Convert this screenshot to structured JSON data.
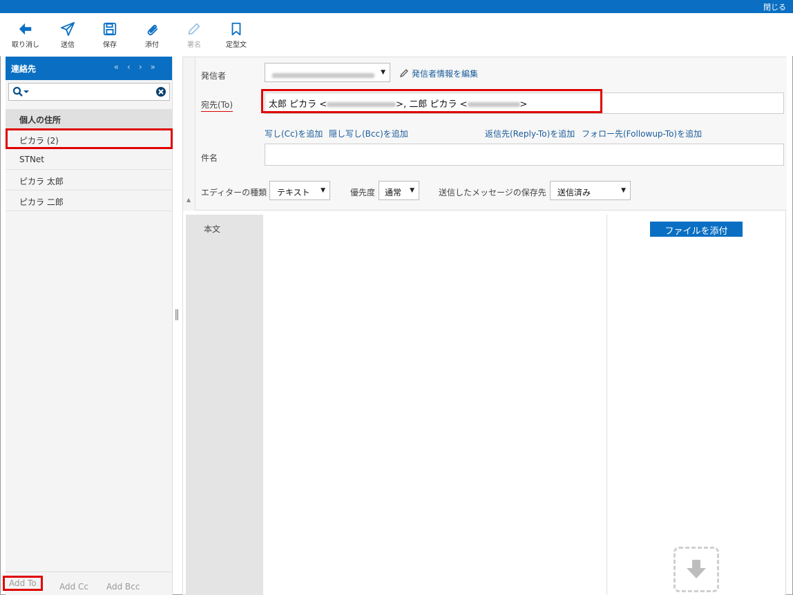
{
  "window": {
    "close_label": "閉じる"
  },
  "toolbar": {
    "undo": "取り消し",
    "send": "送信",
    "save": "保存",
    "attach": "添付",
    "signature": "署名",
    "template": "定型文"
  },
  "sidebar": {
    "title": "連絡先",
    "nav_first": "«",
    "nav_prev": "‹",
    "nav_next": "›",
    "nav_last": "»",
    "group": "個人の住所",
    "items": [
      {
        "label": "ピカラ (2)"
      },
      {
        "label": "STNet"
      },
      {
        "label": "ピカラ 太郎"
      },
      {
        "label": "ピカラ 二郎"
      }
    ],
    "add_to": "Add To",
    "add_cc": "Add Cc",
    "add_bcc": "Add Bcc"
  },
  "form": {
    "from_label": "発信者",
    "edit_sender": "発信者情報を編集",
    "to_label": "宛先(To)",
    "to_name1": "太郎 ピカラ <",
    "to_sep": ">, 二郎 ピカラ <",
    "to_end": ">",
    "add_cc": "写し(Cc)を追加",
    "add_bcc": "隠し写し(Bcc)を追加",
    "add_reply_to": "返信先(Reply-To)を追加",
    "add_followup": "フォロー先(Followup-To)を追加",
    "subject_label": "件名",
    "editor_label": "エディターの種類",
    "editor_value": "テキスト",
    "priority_label": "優先度",
    "priority_value": "通常",
    "save_folder_label": "送信したメッセージの保存先",
    "save_folder_value": "送信済み"
  },
  "body": {
    "label": "本文",
    "attach_button": "ファイルを添付"
  }
}
